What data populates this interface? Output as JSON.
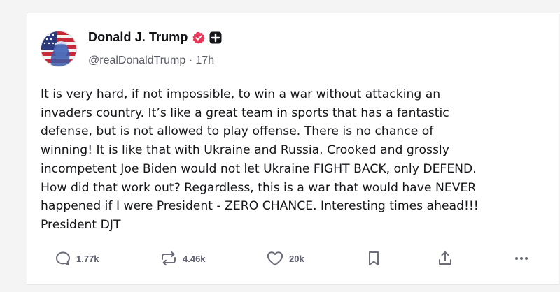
{
  "post": {
    "author": {
      "display_name": "Donald J. Trump",
      "handle_time": "@realDonaldTrump · 17h",
      "avatar_icon": "flag-portrait-avatar",
      "verified_color": "#e8395b"
    },
    "body": "It is very hard, if not impossible, to win a war without attacking an\ninvaders country. It’s like a great team in sports that has a fantastic\ndefense, but is not allowed to play offense. There is no chance of\nwinning! It is like that with Ukraine and Russia. Crooked and grossly\nincompetent Joe Biden would not let Ukraine FIGHT BACK, only DEFEND.\nHow did that work out? Regardless, this is a war that would have NEVER\nhappened if I were President - ZERO CHANCE. Interesting times ahead!!!\nPresident DJT",
    "actions": {
      "reply_count": "1.77k",
      "retruth_count": "4.46k",
      "like_count": "20k"
    }
  }
}
